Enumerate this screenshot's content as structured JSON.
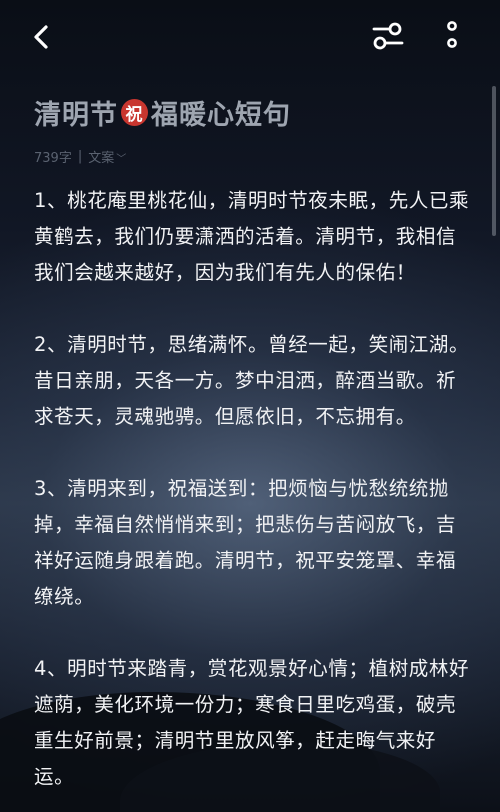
{
  "topbar": {
    "back_icon": "chevron-left-icon",
    "settings_icon": "sliders-icon",
    "more_icon": "more-vertical-icon"
  },
  "article": {
    "title_before": "清明节",
    "title_badge": "祝",
    "title_after": "福暖心短句",
    "word_count": "739字",
    "category": "文案"
  },
  "paragraphs": [
    "1、桃花庵里桃花仙，清明时节夜未眠，先人已乘黄鹤去，我们仍要潇洒的活着。清明节，我相信我们会越来越好，因为我们有先人的保佑！",
    "2、清明时节，思绪满怀。曾经一起，笑闹江湖。昔日亲朋，天各一方。梦中泪洒，醉酒当歌。祈求苍天，灵魂驰骋。但愿依旧，不忘拥有。",
    "3、清明来到，祝福送到：把烦恼与忧愁统统抛掉，幸福自然悄悄来到；把悲伤与苦闷放飞，吉祥好运随身跟着跑。清明节，祝平安笼罩、幸福缭绕。",
    "4、明时节来踏青，赏花观景好心情；植树成林好遮荫，美化环境一份力；寒食日里吃鸡蛋，破壳重生好前景；清明节里放风筝，赶走晦气来好运。"
  ]
}
